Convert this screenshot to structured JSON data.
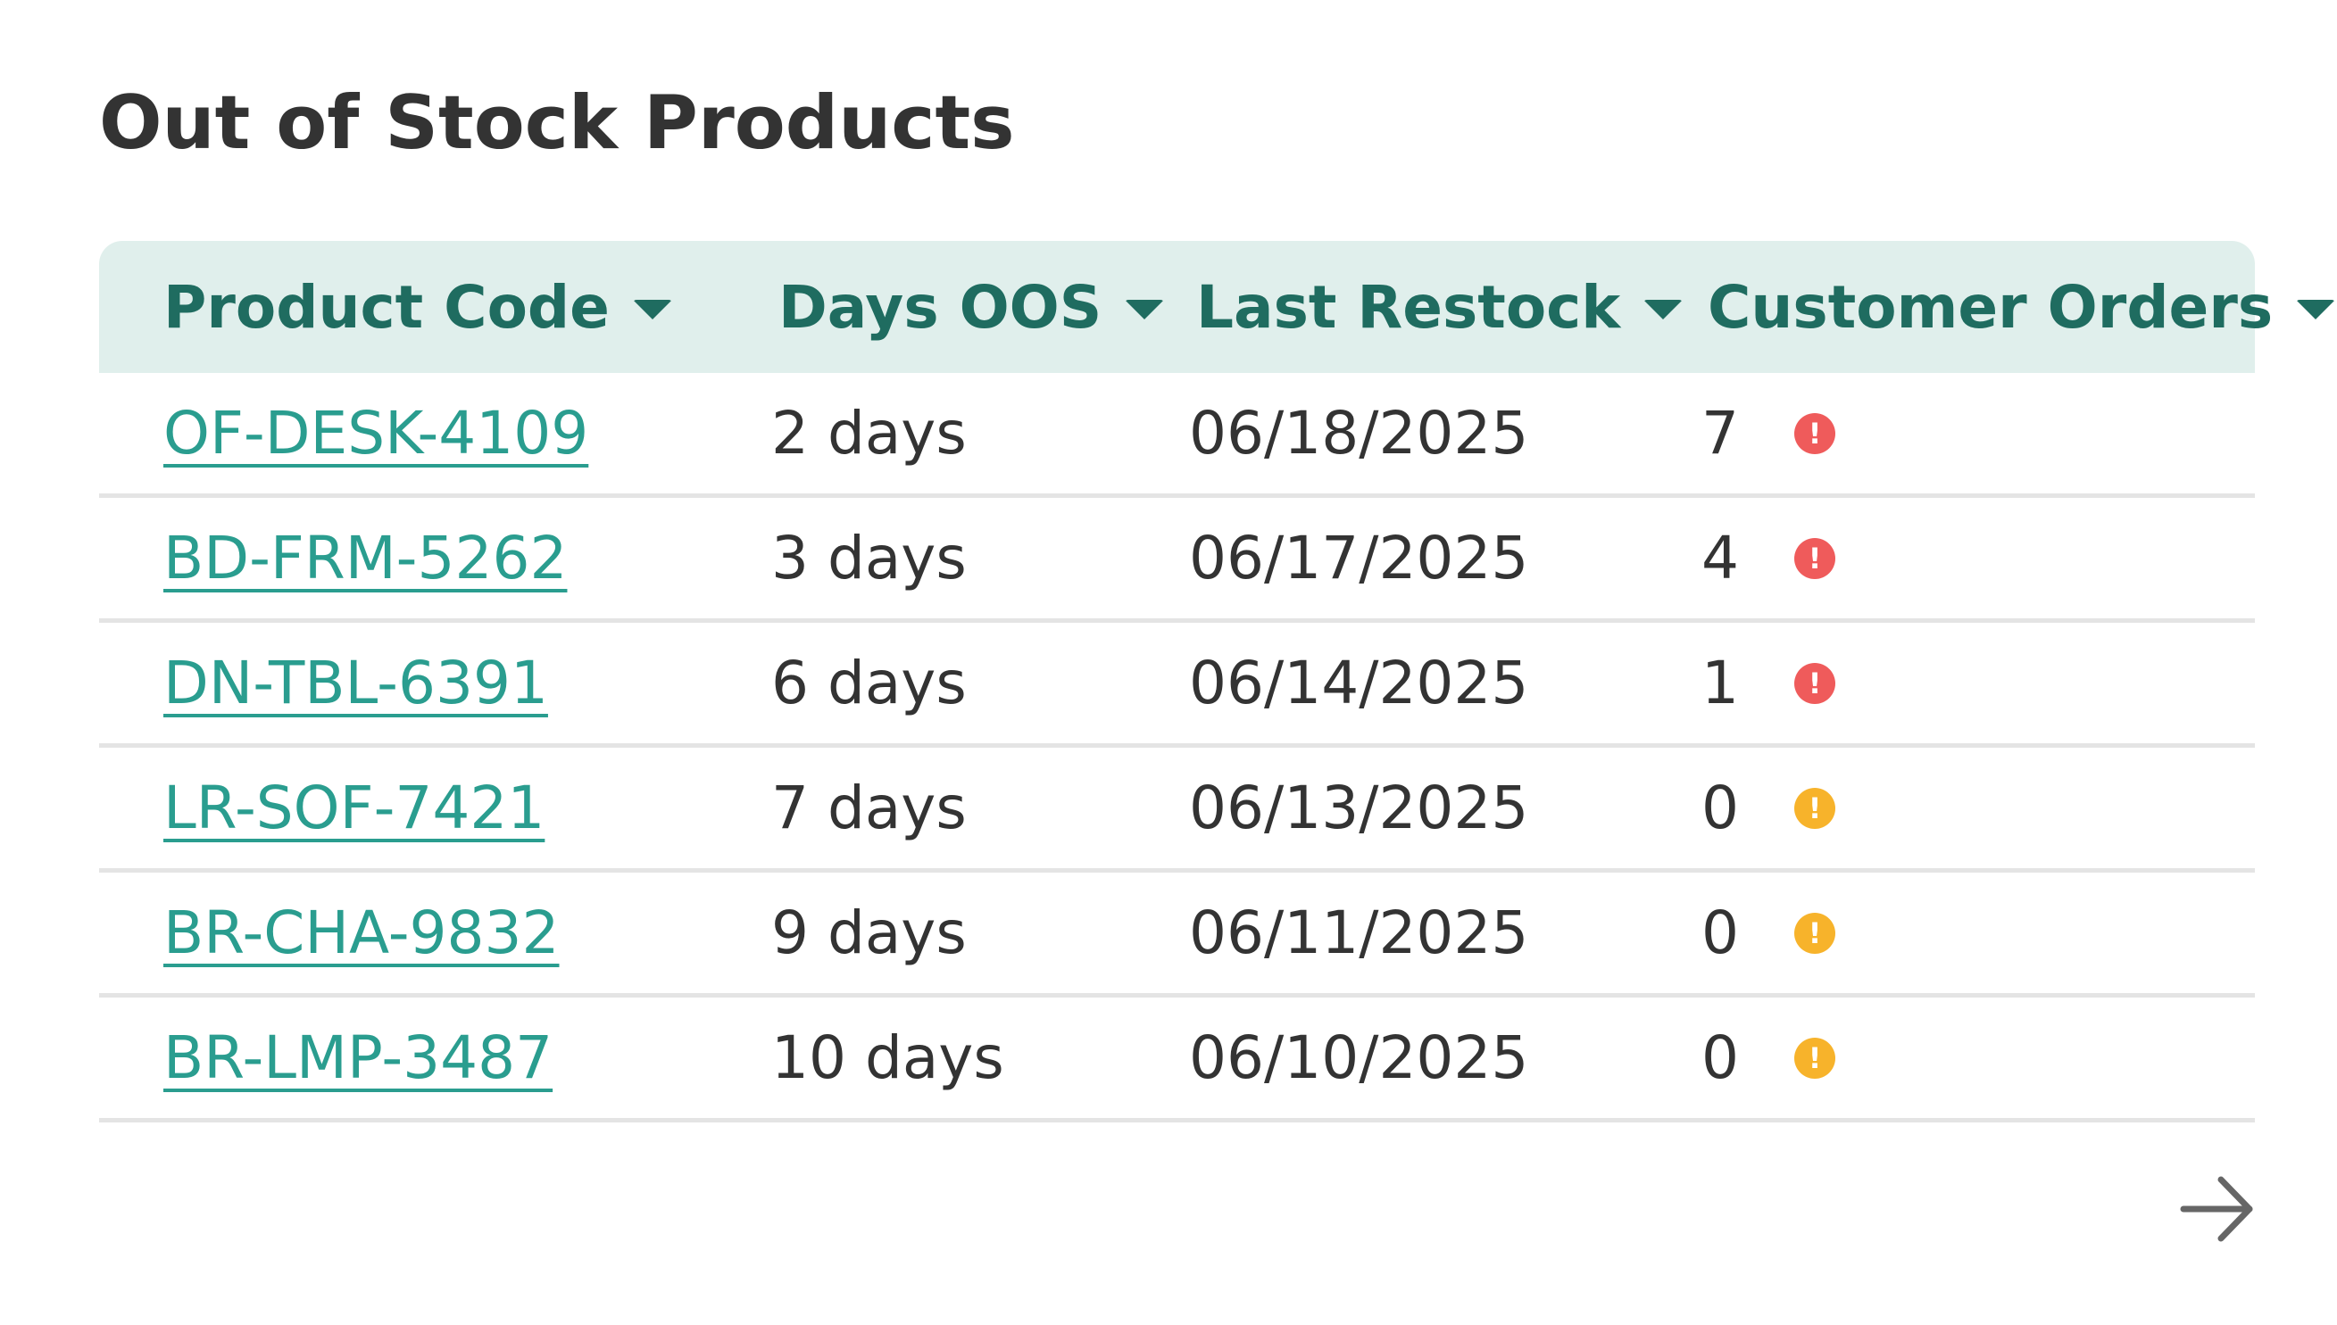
{
  "widget": {
    "title": "Out of Stock Products"
  },
  "table": {
    "columns": [
      {
        "label": "Product Code"
      },
      {
        "label": "Days OOS"
      },
      {
        "label": "Last Restock"
      },
      {
        "label": "Customer Orders"
      }
    ],
    "rows": [
      {
        "code": "OF-DESK-4109",
        "days": "2 days",
        "restock": "06/18/2025",
        "orders": "7",
        "alert": "critical"
      },
      {
        "code": "BD-FRM-5262",
        "days": "3 days",
        "restock": "06/17/2025",
        "orders": "4",
        "alert": "critical"
      },
      {
        "code": "DN-TBL-6391",
        "days": "6 days",
        "restock": "06/14/2025",
        "orders": "1",
        "alert": "critical"
      },
      {
        "code": "LR-SOF-7421",
        "days": "7 days",
        "restock": "06/13/2025",
        "orders": "0",
        "alert": "warning"
      },
      {
        "code": "BR-CHA-9832",
        "days": "9 days",
        "restock": "06/11/2025",
        "orders": "0",
        "alert": "warning"
      },
      {
        "code": "BR-LMP-3487",
        "days": "10 days",
        "restock": "06/10/2025",
        "orders": "0",
        "alert": "warning"
      }
    ]
  },
  "icons": {
    "sort": "caret-down-icon",
    "alert": "exclamation-circle-icon",
    "next": "arrow-right-icon"
  },
  "colors": {
    "header_bg": "#e0efec",
    "header_text": "#1f6c60",
    "link": "#2a9d8f",
    "critical": "#ef5b5b",
    "warning": "#f7b32b"
  }
}
